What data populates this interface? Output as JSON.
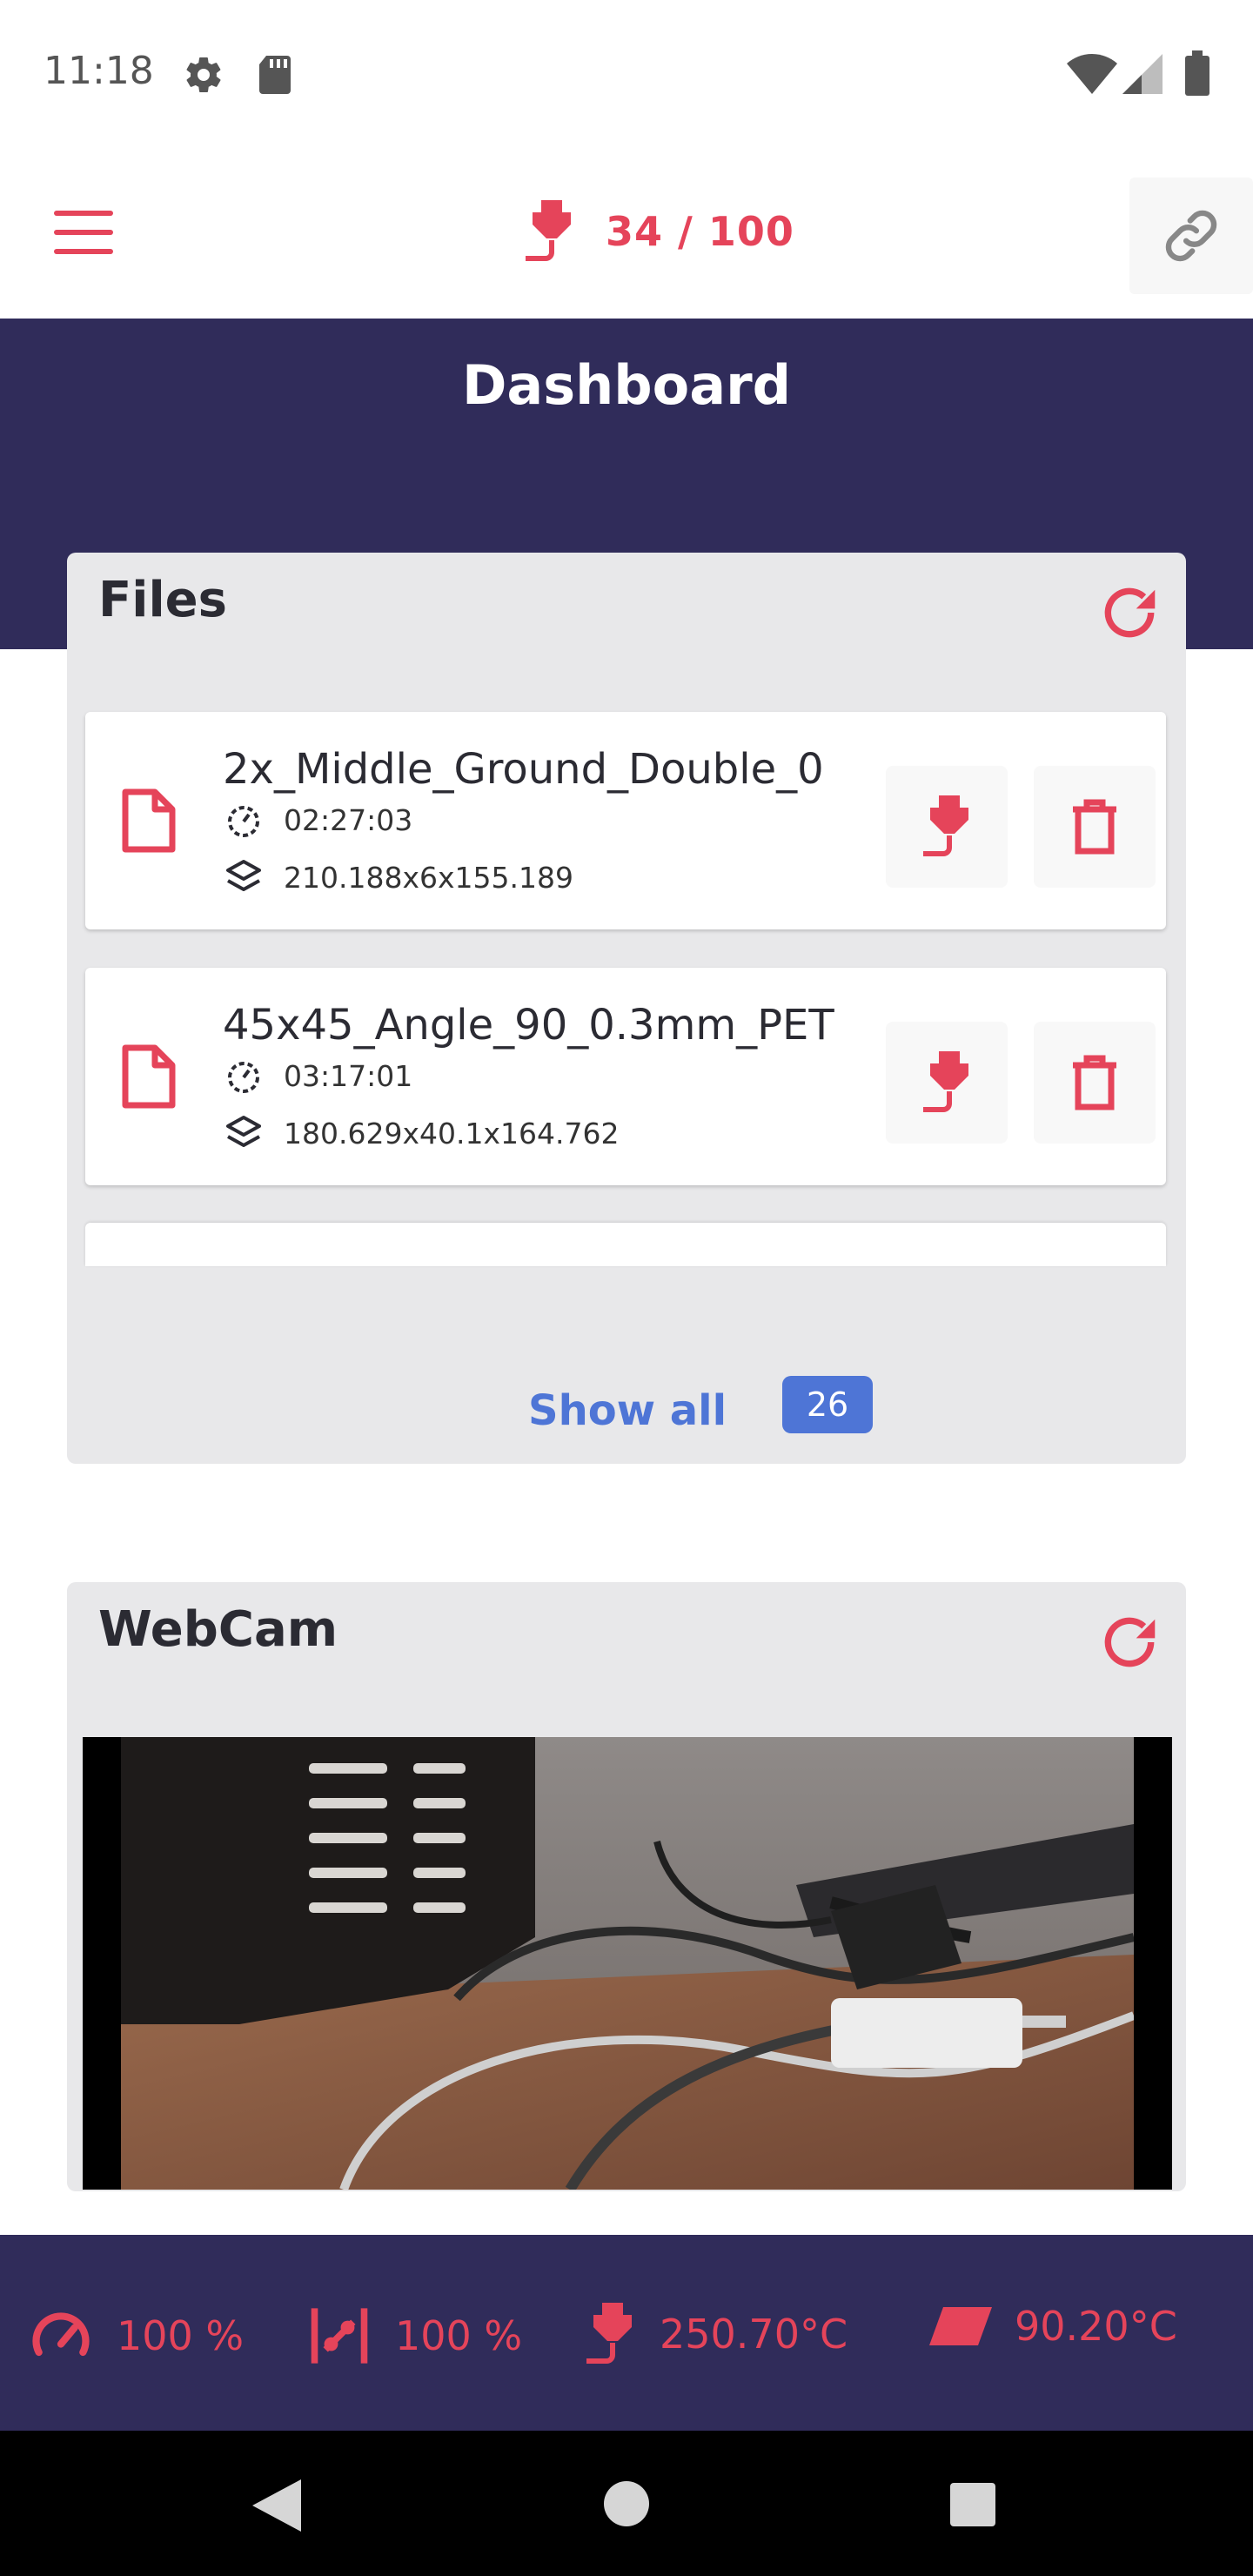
{
  "status_bar": {
    "time": "11:18",
    "icons": [
      "gear-icon",
      "sd-card-icon",
      "wifi-icon",
      "cell-signal-icon",
      "battery-icon"
    ]
  },
  "app_bar": {
    "menu_icon": "hamburger-icon",
    "temperature": {
      "current": "34",
      "separator": "/",
      "target": "100",
      "text": "34 / 100",
      "icon": "extruder-icon"
    },
    "link_icon": "link-icon"
  },
  "header": {
    "title": "Dashboard"
  },
  "files_card": {
    "title": "Files",
    "refresh_icon": "refresh-icon",
    "items": [
      {
        "name": "2x_Middle_Ground_Double_0",
        "duration": "02:27:03",
        "dimensions": "210.188x6x155.189"
      },
      {
        "name": "45x45_Angle_90_0.3mm_PET",
        "duration": "03:17:01",
        "dimensions": "180.629x40.1x164.762"
      }
    ],
    "show_all_label": "Show all",
    "count": "26"
  },
  "webcam_card": {
    "title": "WebCam",
    "refresh_icon": "refresh-icon"
  },
  "bottom_stats": [
    {
      "icon": "speed-gauge-icon",
      "value": "100 %"
    },
    {
      "icon": "flow-icon",
      "value": "100 %"
    },
    {
      "icon": "extruder-icon",
      "value": "250.70°C"
    },
    {
      "icon": "bed-icon",
      "value": "90.20°C"
    }
  ],
  "colors": {
    "accent": "#e5445a",
    "header": "#302c5a",
    "card": "#e8e8ea",
    "link": "#4e75d6"
  }
}
